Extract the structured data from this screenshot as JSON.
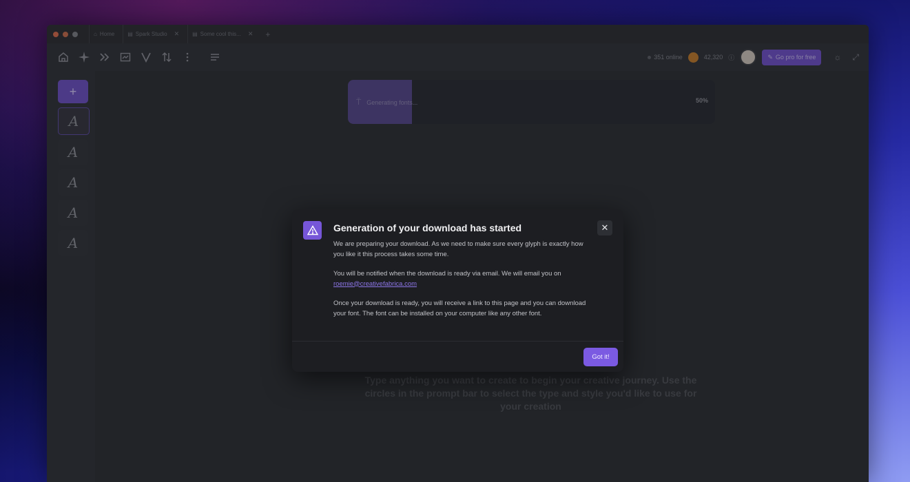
{
  "tabs": [
    {
      "label": "Home",
      "closable": false
    },
    {
      "label": "Spark Studio",
      "closable": true
    },
    {
      "label": "Some cool this...",
      "closable": true
    }
  ],
  "status": {
    "online": "351 online",
    "credits": "42,320",
    "pro_button": "Go pro for free"
  },
  "progress": {
    "label": "Generating fonts...",
    "percent_text": "50%",
    "value": 0.5
  },
  "hint_text": "Type anything you want to create to begin your creative journey. Use the circles in the prompt bar to select the type and style you'd like to use for your creation",
  "sidebar": {
    "add_label": "+",
    "items": [
      "A",
      "A",
      "A",
      "A",
      "A"
    ]
  },
  "modal": {
    "title": "Generation of your download has started",
    "para1": "We are preparing your download. As we need to make sure every glyph is exactly how you like it this process takes some time.",
    "para2": "You will be notified when the download is ready via email. We will email you on",
    "email": "roemie@creativefabrica.com",
    "para3": "Once your download is ready, you will receive a link to this page and you can download your font. The font can be installed on your computer like any other font.",
    "button": "Got it!",
    "close": "✕"
  },
  "colors": {
    "accent": "#7b5ae2",
    "modal_bg": "#1d1e22"
  }
}
